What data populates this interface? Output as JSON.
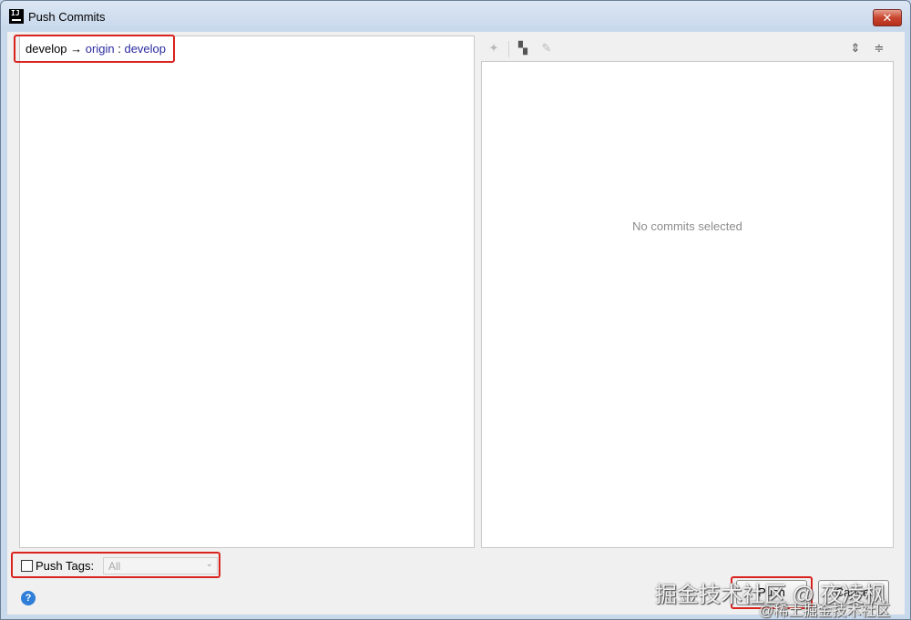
{
  "window": {
    "title": "Push Commits",
    "app_icon_text": "IJ",
    "close_label": "✕"
  },
  "branches": {
    "local": "develop",
    "arrow": "→",
    "remote": "origin",
    "separator": ":",
    "target": "develop"
  },
  "details": {
    "empty_text": "No commits selected"
  },
  "toolbar": {
    "icons": [
      "pin-icon",
      "group-icon",
      "edit-icon",
      "expand-all-icon",
      "collapse-all-icon"
    ]
  },
  "tags": {
    "label": "Push Tags:",
    "checked": false,
    "selected": "All"
  },
  "buttons": {
    "push": "Push",
    "cancel": "Cancel"
  },
  "watermark": {
    "line1": "掘金技术社区 @ 夜凌枫",
    "line2": "@稀土掘金技术社区"
  },
  "colors": {
    "highlight": "#d9231e",
    "remote_branch": "#2a2aa0"
  }
}
